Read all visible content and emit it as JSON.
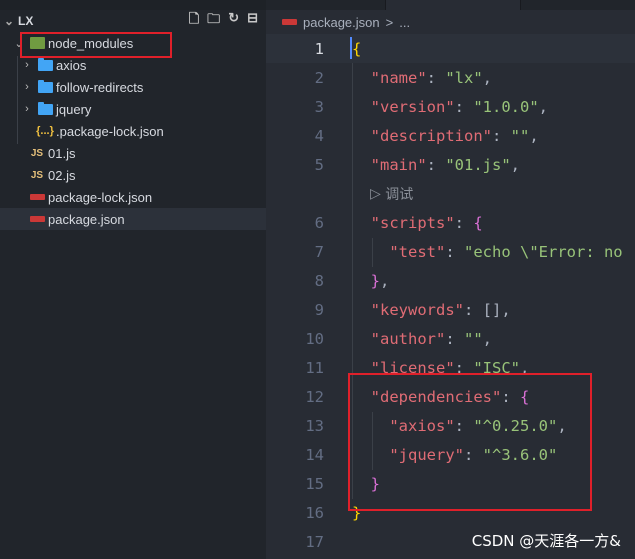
{
  "explorer": {
    "title": "LX",
    "actions": [
      "new-file-icon",
      "new-folder-icon",
      "refresh-icon",
      "collapse-icon"
    ],
    "items": [
      {
        "label": "node_modules",
        "type": "node-folder"
      },
      {
        "label": "axios",
        "type": "folder"
      },
      {
        "label": "follow-redirects",
        "type": "folder"
      },
      {
        "label": "jquery",
        "type": "folder"
      },
      {
        "label": ".package-lock.json",
        "type": "json",
        "icon_text": "{...}"
      },
      {
        "label": "01.js",
        "type": "js",
        "icon_text": "JS"
      },
      {
        "label": "02.js",
        "type": "js",
        "icon_text": "JS"
      },
      {
        "label": "package-lock.json",
        "type": "npm"
      },
      {
        "label": "package.json",
        "type": "npm"
      }
    ]
  },
  "breadcrumb": {
    "file": "package.json",
    "sep": ">",
    "more": "..."
  },
  "code": {
    "line_numbers": [
      "1",
      "2",
      "3",
      "4",
      "5",
      "6",
      "7",
      "8",
      "9",
      "10",
      "11",
      "12",
      "13",
      "14",
      "15",
      "16",
      "17"
    ],
    "codelens": "调试",
    "lines": {
      "l2": [
        "\"name\"",
        "\"lx\""
      ],
      "l3": [
        "\"version\"",
        "\"1.0.0\""
      ],
      "l4": [
        "\"description\"",
        "\"\""
      ],
      "l5": [
        "\"main\"",
        "\"01.js\""
      ],
      "l6": [
        "\"scripts\""
      ],
      "l7": [
        "\"test\"",
        "\"echo \\\"Error: no"
      ],
      "l9": [
        "\"keywords\"",
        "[]"
      ],
      "l10": [
        "\"author\"",
        "\"\""
      ],
      "l11": [
        "\"license\"",
        "\"ISC\""
      ],
      "l12": [
        "\"dependencies\""
      ],
      "l13": [
        "\"axios\"",
        "\"^0.25.0\""
      ],
      "l14": [
        "\"jquery\"",
        "\"^3.6.0\""
      ]
    }
  },
  "watermark": "CSDN @天涯各一方&"
}
